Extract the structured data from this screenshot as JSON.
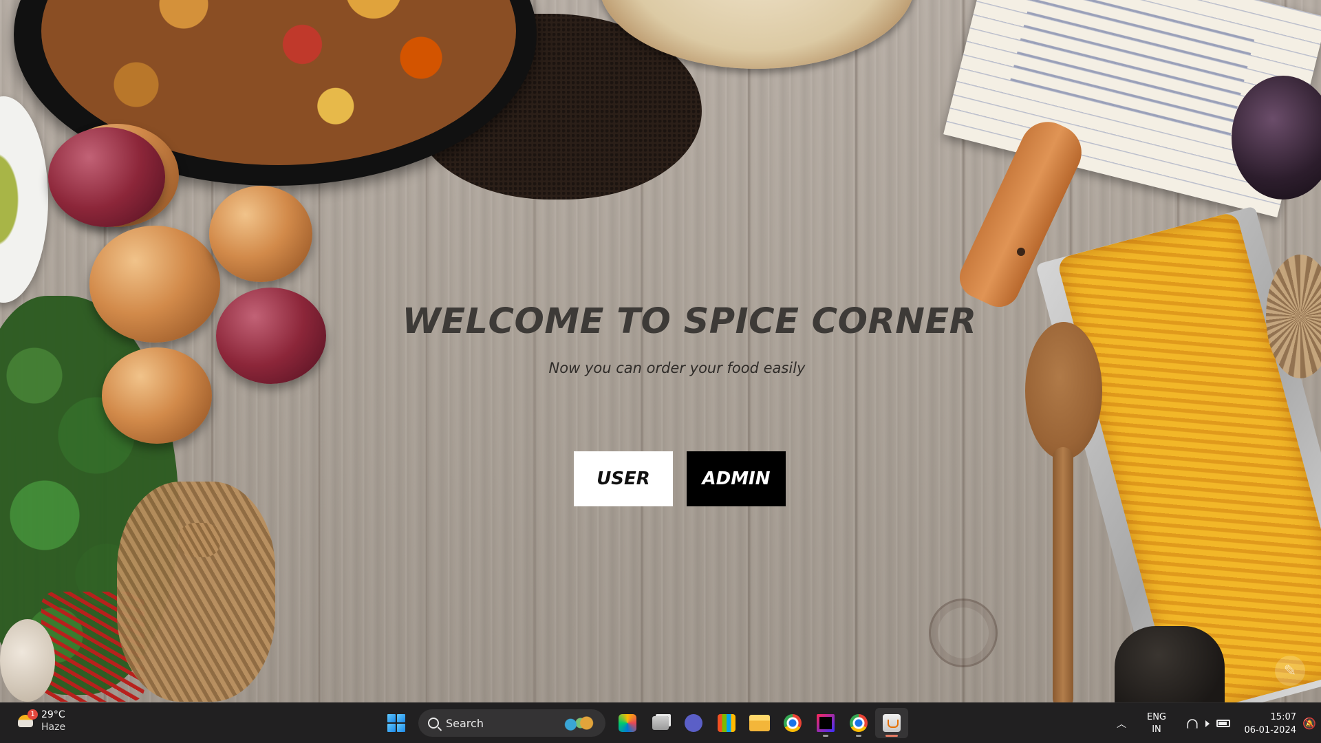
{
  "app": {
    "title": "WELCOME TO SPICE CORNER",
    "subtitle": "Now you can order your food easily",
    "buttons": {
      "user": "USER",
      "admin": "ADMIN"
    }
  },
  "taskbar": {
    "weather": {
      "temperature": "29°C",
      "condition": "Haze",
      "badge": "1",
      "icon": "weather-haze-icon"
    },
    "search": {
      "placeholder": "Search"
    },
    "apps": [
      {
        "name": "start-icon"
      },
      {
        "name": "copilot-icon"
      },
      {
        "name": "task-view-icon"
      },
      {
        "name": "meet-icon"
      },
      {
        "name": "store-icon"
      },
      {
        "name": "file-explorer-icon"
      },
      {
        "name": "chrome-icon"
      },
      {
        "name": "intellij-icon"
      },
      {
        "name": "chrome-profile-icon"
      },
      {
        "name": "java-app-icon"
      }
    ],
    "tray": {
      "language_line1": "ENG",
      "language_line2": "IN",
      "time": "15:07",
      "date": "06-01-2024"
    }
  },
  "colors": {
    "title": "#3d3a37",
    "user_button_bg": "#ffffff",
    "admin_button_bg": "#000000",
    "taskbar_bg": "#212021"
  }
}
